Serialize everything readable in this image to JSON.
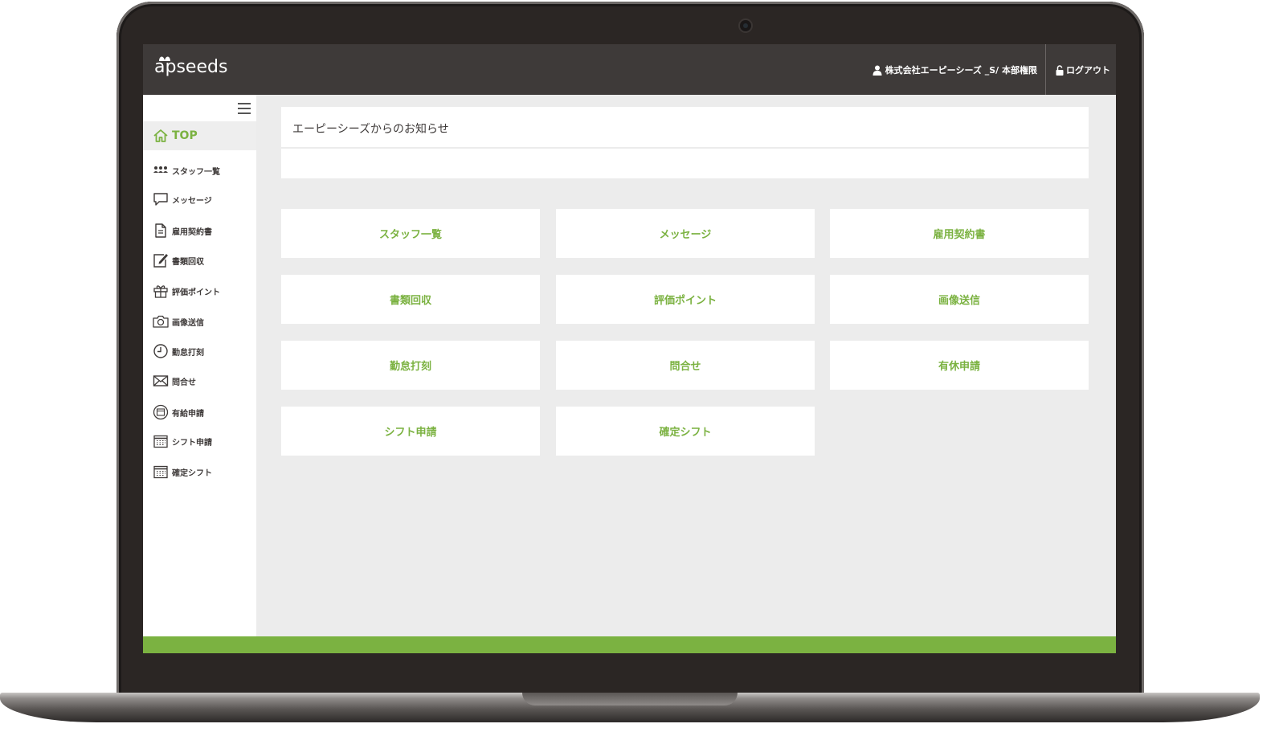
{
  "header": {
    "logo": "apseeds",
    "user_label": "株式会社エーピーシーズ _S/ 本部権限",
    "logout_label": "ログアウト"
  },
  "sidebar": {
    "top_label": "TOP",
    "items": [
      {
        "label": "スタッフ一覧",
        "icon": "users-icon"
      },
      {
        "label": "メッセージ",
        "icon": "chat-icon"
      },
      {
        "label": "雇用契約書",
        "icon": "document-icon"
      },
      {
        "label": "書類回収",
        "icon": "edit-icon"
      },
      {
        "label": "評価ポイント",
        "icon": "gift-icon"
      },
      {
        "label": "画像送信",
        "icon": "camera-icon"
      },
      {
        "label": "勤怠打刻",
        "icon": "clock-icon"
      },
      {
        "label": "問合せ",
        "icon": "mail-icon"
      },
      {
        "label": "有給申請",
        "icon": "calendar-circle-icon"
      },
      {
        "label": "シフト申請",
        "icon": "calendar-icon"
      },
      {
        "label": "確定シフト",
        "icon": "calendar-icon"
      }
    ]
  },
  "notice": {
    "title": "エーピーシーズからのお知らせ"
  },
  "tiles": [
    "スタッフ一覧",
    "メッセージ",
    "雇用契約書",
    "書類回収",
    "評価ポイント",
    "画像送信",
    "勤怠打刻",
    "問合せ",
    "有休申請",
    "シフト申請",
    "確定シフト"
  ],
  "colors": {
    "accent": "#7bb241",
    "topbar": "#3e3a39",
    "background": "#ececec"
  }
}
